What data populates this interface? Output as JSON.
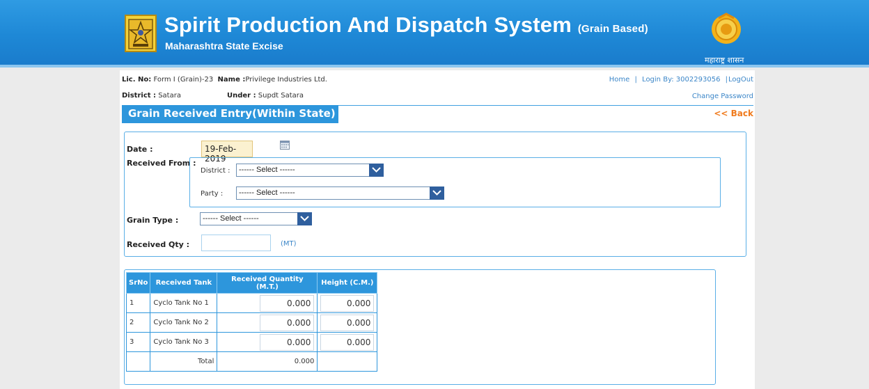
{
  "header": {
    "title": "Spirit Production And Dispatch System",
    "title_suffix": "(Grain Based)",
    "subtitle": "Maharashtra State Excise",
    "gov_text": "महाराष्ट्र शासन"
  },
  "info": {
    "lic_label": "Lic. No:",
    "lic_value": "Form I (Grain)-23",
    "name_label": "Name :",
    "name_value": "Privilege Industries Ltd.",
    "district_label": "District :",
    "district_value": "Satara",
    "under_label": "Under :",
    "under_value": "Supdt Satara"
  },
  "links": {
    "home": "Home",
    "sep1": "|",
    "login": "Login By: 3002293056",
    "sep2": "|",
    "logout": "LogOut",
    "change_password": "Change Password",
    "back": "<< Back"
  },
  "section_title": "Grain Received Entry(Within State)",
  "form": {
    "date_label": "Date :",
    "date_value": "19-Feb-2019",
    "received_from_label": "Received From :",
    "district_label": "District :",
    "district_select": "------ Select ------",
    "party_label": "Party :",
    "party_select": "------ Select ------",
    "grain_type_label": "Grain Type :",
    "grain_type_select": "------ Select ------",
    "received_qty_label": "Received Qty :",
    "received_qty_value": "",
    "unit": "(MT)"
  },
  "table": {
    "headers": [
      "SrNo",
      "Received Tank",
      "Received Quantity (M.T.)",
      "Height (C.M.)"
    ],
    "rows": [
      {
        "srno": "1",
        "tank": "Cyclo Tank No 1",
        "qty": "0.000",
        "height": "0.000"
      },
      {
        "srno": "2",
        "tank": "Cyclo Tank No 2",
        "qty": "0.000",
        "height": "0.000"
      },
      {
        "srno": "3",
        "tank": "Cyclo Tank No 3",
        "qty": "0.000",
        "height": "0.000"
      }
    ],
    "total_label": "Total",
    "total_value": "0.000"
  }
}
